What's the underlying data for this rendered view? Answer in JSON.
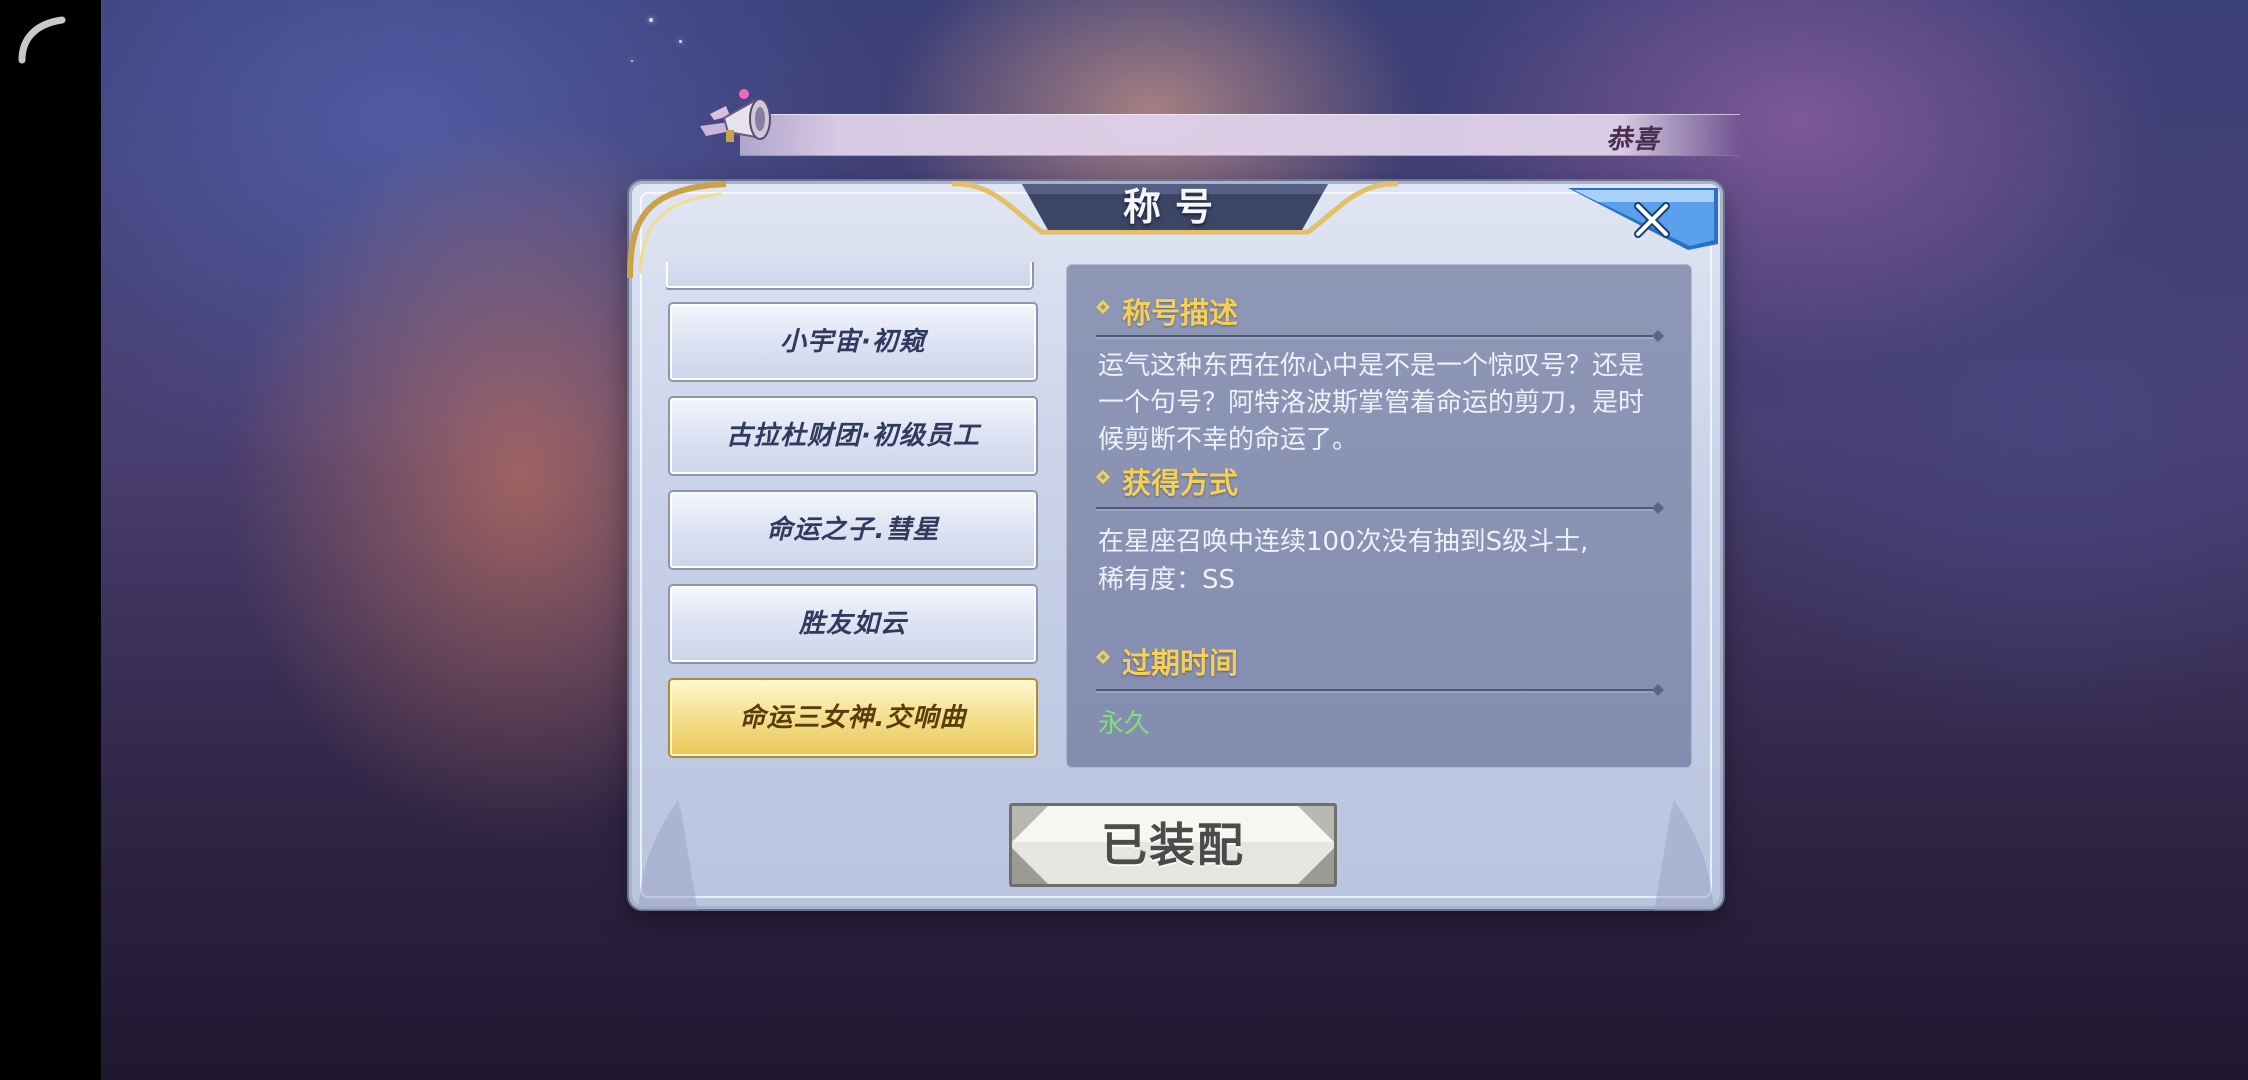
{
  "broadcast": {
    "text": "恭喜"
  },
  "dialog": {
    "title": "称号",
    "close_icon": "close-x-icon"
  },
  "title_list": {
    "items": [
      {
        "label": "小宇宙·初窥",
        "selected": false
      },
      {
        "label": "古拉杜财团·初级员工",
        "selected": false
      },
      {
        "label": "命运之子.彗星",
        "selected": false
      },
      {
        "label": "胜友如云",
        "selected": false
      },
      {
        "label": "命运三女神.交响曲",
        "selected": true
      }
    ]
  },
  "info": {
    "description": {
      "heading": "称号描述",
      "text": "运气这种东西在你心中是不是一个惊叹号？还是一个句号？阿特洛波斯掌管着命运的剪刀，是时候剪断不幸的命运了。"
    },
    "obtain": {
      "heading": "获得方式",
      "text": "在星座召唤中连续100次没有抽到S级斗士,",
      "rarity": "稀有度：SS"
    },
    "expiry": {
      "heading": "过期时间",
      "value": "永久"
    }
  },
  "equip_button": {
    "label": "已装配"
  },
  "colors": {
    "heading_gold": "#f6cf58",
    "expiry_green": "#7fe07a",
    "selected_gold": "#e8c659"
  }
}
